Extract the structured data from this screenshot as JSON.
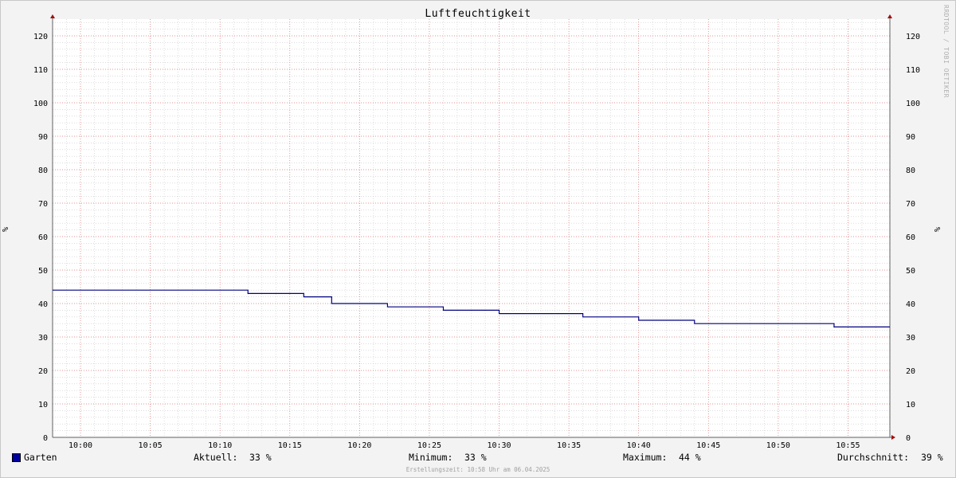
{
  "watermark": "RRDTOOL / TOBI OETIKER",
  "legend": {
    "series_label": "Garten",
    "current_label": "Aktuell:",
    "current_value": "33 %",
    "min_label": "Minimum:",
    "min_value": "33 %",
    "max_label": "Maximum:",
    "max_value": "44 %",
    "avg_label": "Durchschnitt:",
    "avg_value": "39 %"
  },
  "footer": "Erstellungszeit: 10:58 Uhr am 06.04.2025",
  "colors": {
    "series": "#000080",
    "minor_grid": "#c8c8c8",
    "major_grid": "#e07a7a",
    "axis": "#606060",
    "arrow": "#a01010"
  },
  "chart_data": {
    "type": "line",
    "title": "Luftfeuchtigkeit",
    "ylabel": "%",
    "ylabel_right": "%",
    "ylim": [
      0,
      125
    ],
    "y_ticks": [
      0,
      10,
      20,
      30,
      40,
      50,
      60,
      70,
      80,
      90,
      100,
      110,
      120
    ],
    "xlim": [
      "09:58",
      "10:58"
    ],
    "x_ticks": [
      "10:00",
      "10:05",
      "10:10",
      "10:15",
      "10:20",
      "10:25",
      "10:30",
      "10:35",
      "10:40",
      "10:45",
      "10:50",
      "10:55"
    ],
    "grid": true,
    "legend_position": "bottom",
    "series": [
      {
        "name": "Garten",
        "step": true,
        "points": [
          {
            "x": "09:58",
            "y": 44
          },
          {
            "x": "10:12",
            "y": 43
          },
          {
            "x": "10:16",
            "y": 42
          },
          {
            "x": "10:18",
            "y": 40
          },
          {
            "x": "10:22",
            "y": 39
          },
          {
            "x": "10:26",
            "y": 38
          },
          {
            "x": "10:30",
            "y": 37
          },
          {
            "x": "10:36",
            "y": 36
          },
          {
            "x": "10:40",
            "y": 35
          },
          {
            "x": "10:44",
            "y": 34
          },
          {
            "x": "10:54",
            "y": 33
          },
          {
            "x": "10:58",
            "y": 33
          }
        ]
      }
    ]
  }
}
